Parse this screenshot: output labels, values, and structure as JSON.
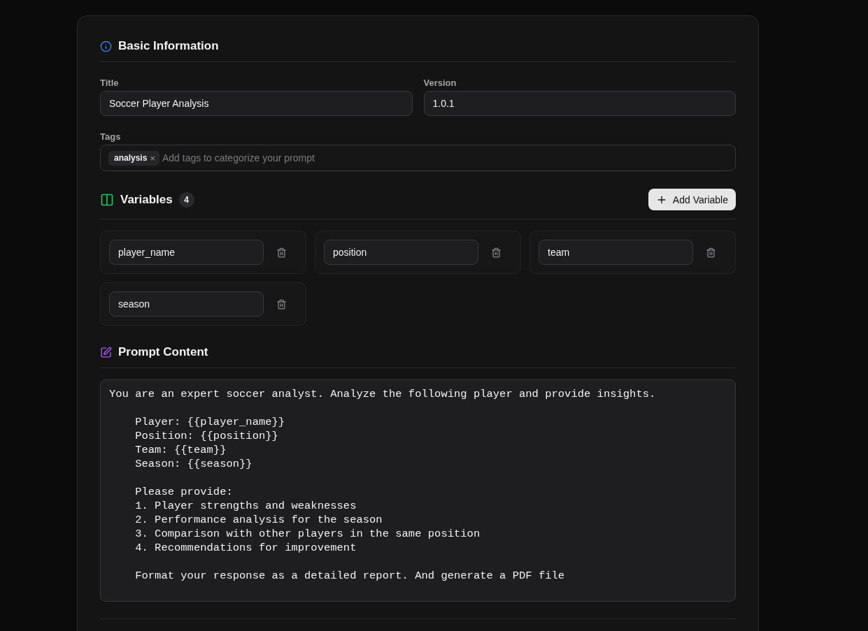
{
  "basic_information": {
    "heading": "Basic Information",
    "title_field": {
      "label": "Title",
      "value": "Soccer Player Analysis"
    },
    "version_field": {
      "label": "Version",
      "value": "1.0.1"
    },
    "tags_field": {
      "label": "Tags",
      "tags": [
        "analysis"
      ],
      "remove_glyph": "×",
      "placeholder": "Add tags to categorize your prompt"
    }
  },
  "variables": {
    "heading": "Variables",
    "count": "4",
    "add_button": "Add Variable",
    "items": [
      {
        "name": "player_name"
      },
      {
        "name": "position"
      },
      {
        "name": "team"
      },
      {
        "name": "season"
      }
    ]
  },
  "prompt_content": {
    "heading": "Prompt Content",
    "text": "You are an expert soccer analyst. Analyze the following player and provide insights.\n\n    Player: {{player_name}}\n    Position: {{position}}\n    Team: {{team}}\n    Season: {{season}}\n\n    Please provide:\n    1. Player strengths and weaknesses\n    2. Performance analysis for the season\n    3. Comparison with other players in the same position\n    4. Recommendations for improvement\n\n    Format your response as a detailed report. And generate a PDF file"
  }
}
